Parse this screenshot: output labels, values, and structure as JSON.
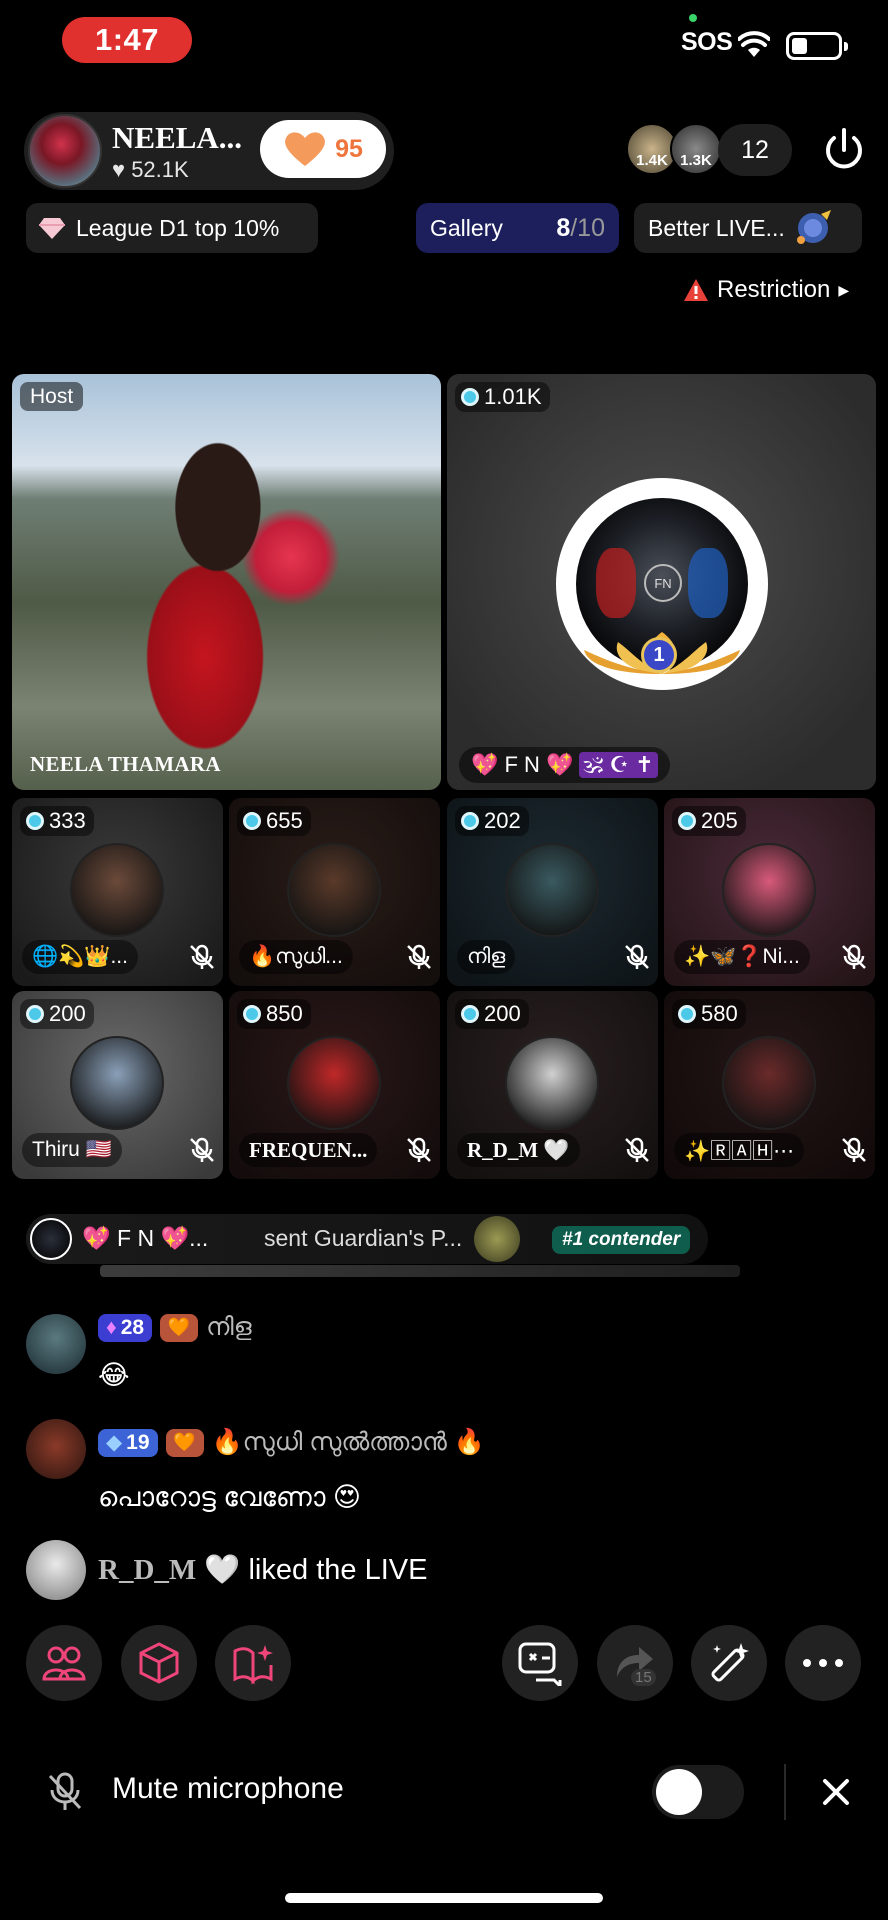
{
  "status_bar": {
    "time": "1:47",
    "sos": "SOS"
  },
  "host": {
    "name": "NEELA...",
    "likes": "52.1K",
    "like_count": "95",
    "viewers": [
      "1.4K",
      "1.3K"
    ],
    "viewer_count": "12"
  },
  "chips": {
    "league": "League D1 top 10%",
    "gallery_label": "Gallery",
    "gallery_current": "8",
    "gallery_total": "/10",
    "better": "Better LIVE...",
    "restriction": "Restriction"
  },
  "host_tile": {
    "badge": "Host",
    "caption": "NEELA THAMARA"
  },
  "guest_tile": {
    "count": "1.01K",
    "name": "💖 F N 💖",
    "symbols": "🕉 ☪ ✝",
    "rank": "1",
    "avatar_text": "FN"
  },
  "guests": [
    {
      "count": "333",
      "name": "🌐💫👑...",
      "serif": false,
      "colors": [
        "#3a3a3a",
        "#1a1a1a"
      ],
      "avatar": "#6b4a3a"
    },
    {
      "count": "655",
      "name": "🔥സുധി...",
      "serif": false,
      "colors": [
        "#2a1c18",
        "#140e0c"
      ],
      "avatar": "#5a3a2a"
    },
    {
      "count": "202",
      "name": "നിള",
      "serif": false,
      "colors": [
        "#1c2a30",
        "#0e1418"
      ],
      "avatar": "#3a5a60"
    },
    {
      "count": "205",
      "name": "✨🦋❓Ni...",
      "serif": false,
      "colors": [
        "#4a2a38",
        "#241418"
      ],
      "avatar": "#d85a7a"
    },
    {
      "count": "200",
      "name": "Thiru 🇺🇸",
      "serif": false,
      "colors": [
        "#6a6a6a",
        "#3a3a3a"
      ],
      "avatar": "#8aa0b8"
    },
    {
      "count": "850",
      "name": "FREQUEN...",
      "serif": true,
      "colors": [
        "#2a1818",
        "#140c0c"
      ],
      "avatar": "#c02828"
    },
    {
      "count": "200",
      "name": "R_D_M 🤍",
      "serif": true,
      "colors": [
        "#2a2020",
        "#141010"
      ],
      "avatar": "#d0d0d0"
    },
    {
      "count": "580",
      "name": "✨🅁🄰🄷⋯",
      "serif": false,
      "colors": [
        "#241616",
        "#120a0a"
      ],
      "avatar": "#6a2a2a"
    }
  ],
  "gift_banner": {
    "sender": "💖 F N 💖...",
    "text": "sent Guardian's P...",
    "contender": "#1 contender"
  },
  "chat": [
    {
      "level": "28",
      "name": "നിള",
      "message": "😂",
      "level_color": "#3b3ed1",
      "avatar": "#3a5a60"
    },
    {
      "level": "19",
      "name": "🔥സുധി സുൽത്താൻ 🔥",
      "message": "പൊറോട്ട വേണോ 😍",
      "level_color": "#3c64d6",
      "avatar": "#4a2a1a"
    }
  ],
  "liked": {
    "user": "R_D_M",
    "text": "🤍 liked the LIVE"
  },
  "action_bar": {
    "share_count": "15"
  },
  "mute": {
    "label": "Mute microphone"
  },
  "colors": {
    "accent_pink": "#f0457a",
    "like_orange": "#f0753c",
    "gallery_bg": "#1c1f5c",
    "warning_red": "#e8413a"
  }
}
